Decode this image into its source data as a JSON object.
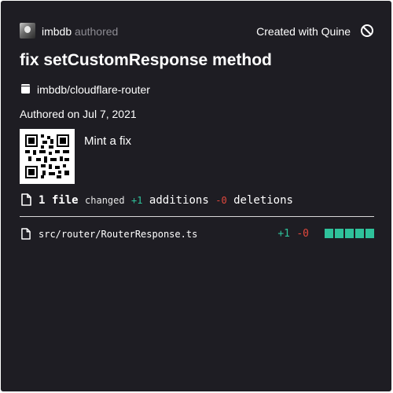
{
  "header": {
    "author": "imbdb",
    "author_verb": "authored",
    "created_with": "Created with Quine",
    "brand_icon": "quine-icon"
  },
  "title": "fix setCustomResponse method",
  "repo": {
    "icon": "repo-icon",
    "name": "imbdb/cloudflare-router"
  },
  "authored_on": "Authored on Jul 7, 2021",
  "mint_label": "Mint a fix",
  "summary": {
    "file_count": "1 file",
    "changed": "changed",
    "additions_count": "+1",
    "additions_label": "additions",
    "deletions_count": "-0",
    "deletions_label": "deletions"
  },
  "files": [
    {
      "path": "src/router/RouterResponse.ts",
      "additions": "+1",
      "deletions": "-0",
      "change_blocks_added": 5,
      "change_blocks_total": 5
    }
  ],
  "colors": {
    "background": "#1e1d23",
    "addition": "#2fc29b",
    "deletion": "#e2483d",
    "muted": "#8d8c93"
  }
}
